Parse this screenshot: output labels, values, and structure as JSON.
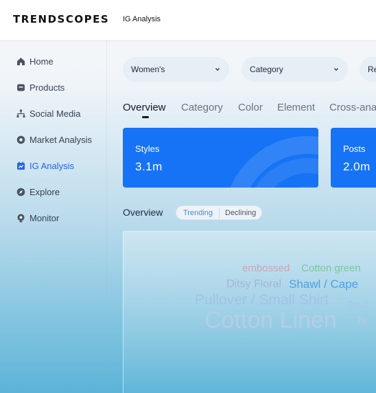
{
  "header": {
    "logo": "TRENDSCOPES",
    "breadcrumb": "IG Analysis"
  },
  "sidebar": {
    "items": [
      {
        "label": "Home",
        "icon": "home-icon",
        "active": false
      },
      {
        "label": "Products",
        "icon": "products-icon",
        "active": false
      },
      {
        "label": "Social Media",
        "icon": "social-media-icon",
        "active": false
      },
      {
        "label": "Market Analysis",
        "icon": "market-analysis-icon",
        "active": false
      },
      {
        "label": "IG Analysis",
        "icon": "ig-analysis-icon",
        "active": true
      },
      {
        "label": "Explore",
        "icon": "explore-icon",
        "active": false
      },
      {
        "label": "Monitor",
        "icon": "monitor-icon",
        "active": false
      }
    ]
  },
  "filters": [
    {
      "value": "Women's"
    },
    {
      "value": "Category"
    },
    {
      "value": "Re"
    }
  ],
  "tabs": [
    {
      "label": "Overview",
      "active": true
    },
    {
      "label": "Category",
      "active": false
    },
    {
      "label": "Color",
      "active": false
    },
    {
      "label": "Element",
      "active": false
    },
    {
      "label": "Cross-ana",
      "active": false
    }
  ],
  "cards": [
    {
      "title": "Styles",
      "value": "3.1m"
    },
    {
      "title": "Posts",
      "value": "2.0m"
    }
  ],
  "overview": {
    "label": "Overview",
    "toggle": {
      "trending": "Trending",
      "declining": "Declining",
      "selected": "Trending"
    }
  },
  "word_cloud": {
    "words": [
      {
        "text": "embossed",
        "color": "#c9a5b5"
      },
      {
        "text": "Cotton green",
        "color": "#7cc6a2"
      },
      {
        "text": "Ditsy Floral",
        "color": "#a6b4d6"
      },
      {
        "text": "Shawl / Cape",
        "color": "#4f9fe8"
      },
      {
        "text": "Pullover / Small Shirt",
        "color": "#a3c2e6"
      },
      {
        "text": "Tie C",
        "color": "#a8c8e6"
      },
      {
        "text": "Cotton Linen",
        "color": "#b6cde4"
      },
      {
        "text": "Te",
        "color": "#b6cde4"
      }
    ]
  },
  "colors": {
    "accent": "#1673f5",
    "active_nav": "#2563eb"
  }
}
